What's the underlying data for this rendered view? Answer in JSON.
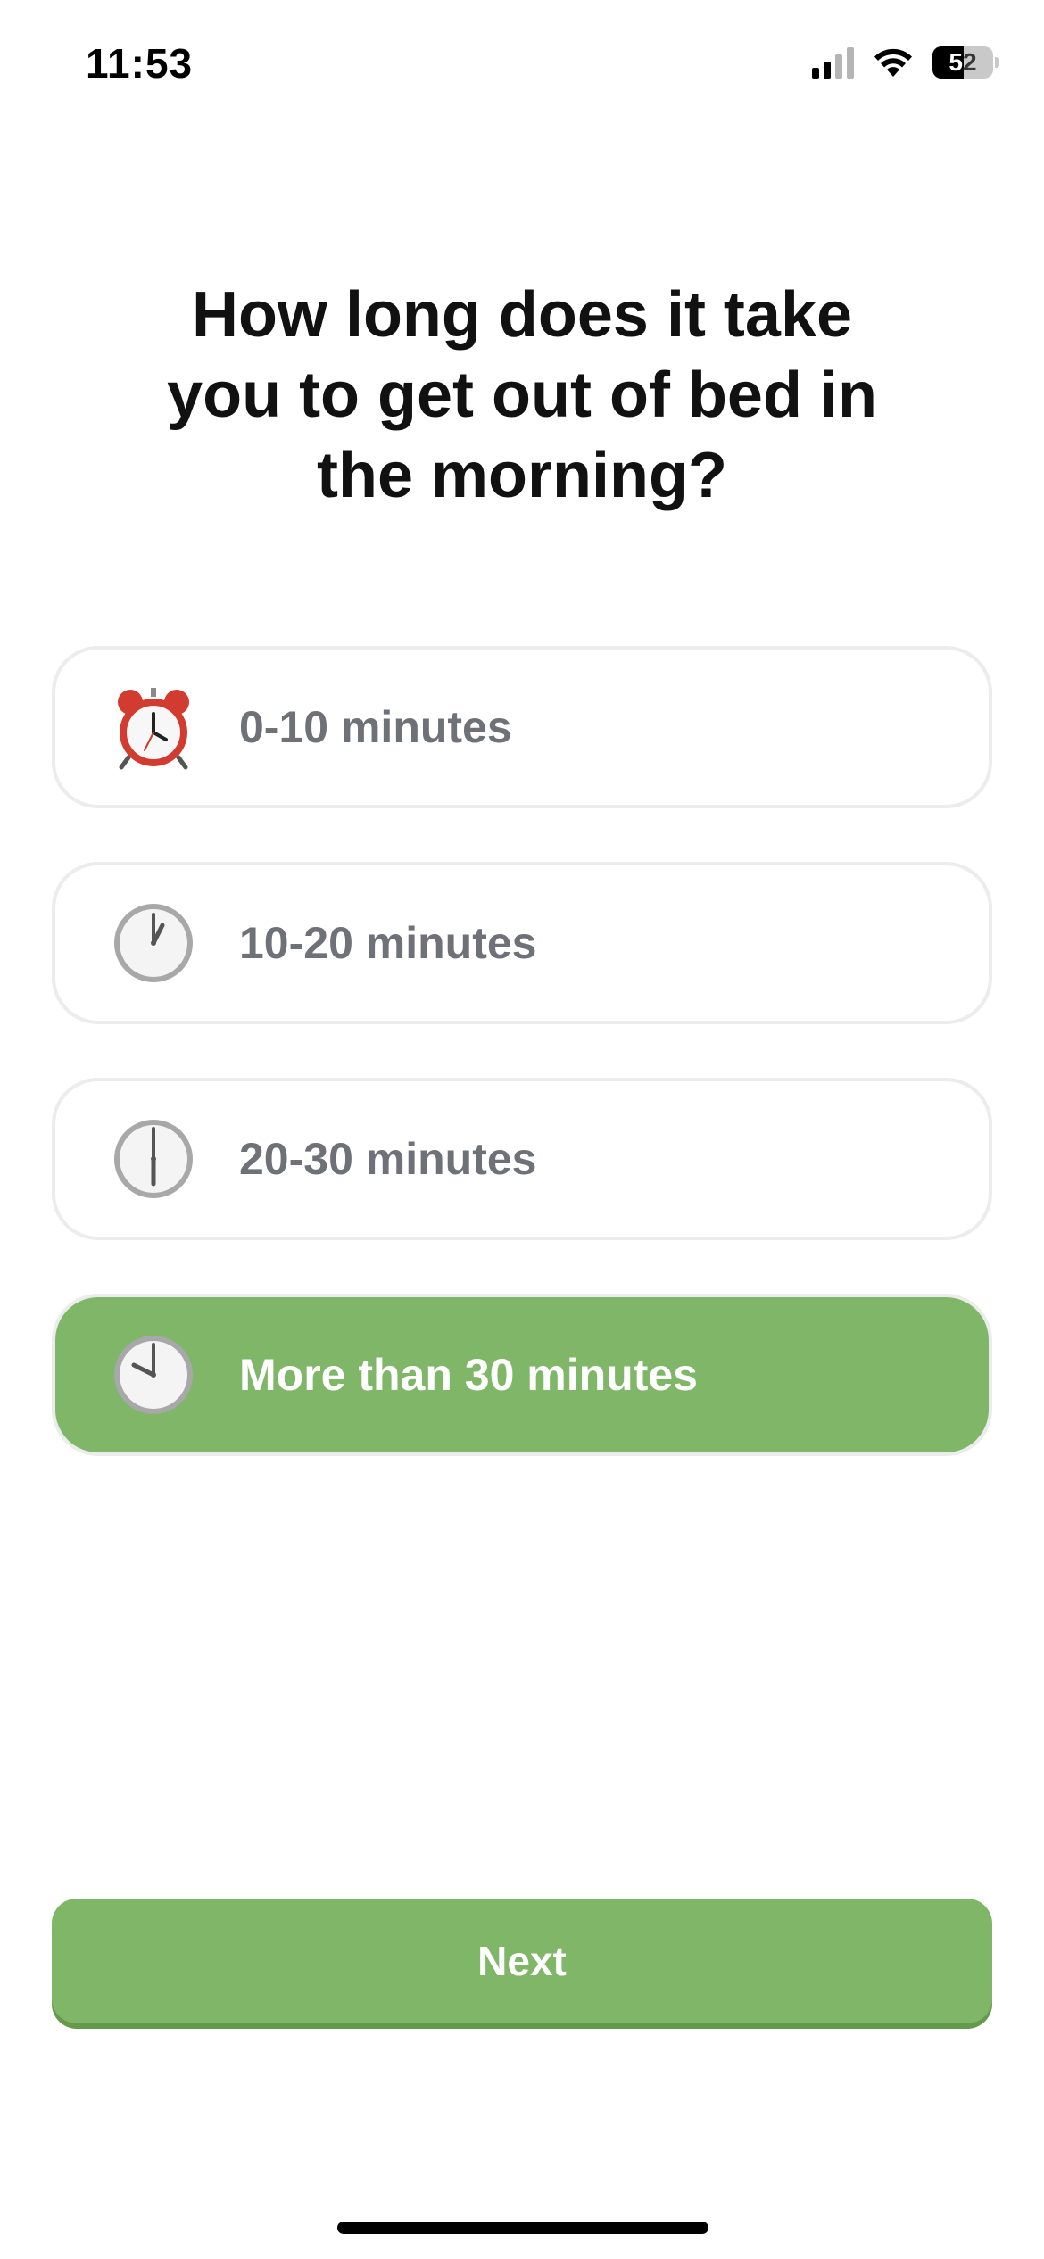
{
  "status_bar": {
    "time": "11:53",
    "battery_percent": "52",
    "battery_level": 0.52
  },
  "question": "How long does it take you to get out of bed in the morning?",
  "options": [
    {
      "label": "0-10 minutes",
      "icon": "alarm-clock-icon",
      "selected": false
    },
    {
      "label": "10-20 minutes",
      "icon": "clock-one-icon",
      "selected": false
    },
    {
      "label": "20-30 minutes",
      "icon": "clock-six-icon",
      "selected": false
    },
    {
      "label": "More than 30 minutes",
      "icon": "clock-ten-icon",
      "selected": true
    }
  ],
  "next_button": {
    "label": "Next"
  },
  "colors": {
    "accent": "#7fb667",
    "option_text": "#6f7178",
    "option_border": "#ececec"
  }
}
